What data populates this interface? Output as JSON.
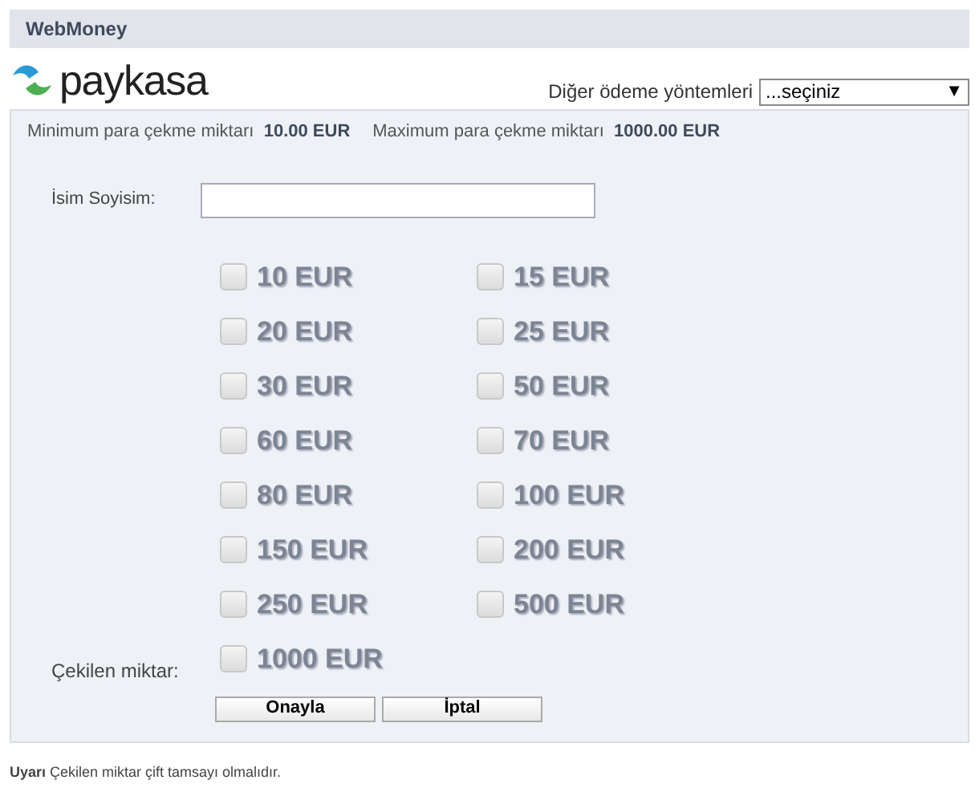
{
  "header": {
    "title": "WebMoney"
  },
  "logo": {
    "text": "paykasa"
  },
  "other_methods": {
    "label": "Diğer ödeme yöntemleri",
    "value": "...seçiniz",
    "caret": "▼"
  },
  "limits": [
    {
      "label": "Minimum para çekme miktarı",
      "value": "10.00 EUR"
    },
    {
      "label": "Maximum para çekme miktarı",
      "value": "1000.00 EUR"
    }
  ],
  "name_field": {
    "label": "İsim Soyisim:"
  },
  "amount_label": "Çekilen miktar:",
  "amounts": [
    {
      "label": "10 EUR",
      "checked": false
    },
    {
      "label": "15 EUR",
      "checked": false
    },
    {
      "label": "20 EUR",
      "checked": false
    },
    {
      "label": "25 EUR",
      "checked": false
    },
    {
      "label": "30 EUR",
      "checked": false
    },
    {
      "label": "50 EUR",
      "checked": false
    },
    {
      "label": "60 EUR",
      "checked": false
    },
    {
      "label": "70 EUR",
      "checked": false
    },
    {
      "label": "80 EUR",
      "checked": false
    },
    {
      "label": "100 EUR",
      "checked": false
    },
    {
      "label": "150 EUR",
      "checked": false
    },
    {
      "label": "200 EUR",
      "checked": false
    },
    {
      "label": "250 EUR",
      "checked": false
    },
    {
      "label": "500 EUR",
      "checked": false
    },
    {
      "label": "1000 EUR",
      "checked": false
    }
  ],
  "buttons": [
    "Onayla",
    "İptal"
  ],
  "warning": "**Uyarı** Çekilen miktar çift tamsayı olmalıdır."
}
